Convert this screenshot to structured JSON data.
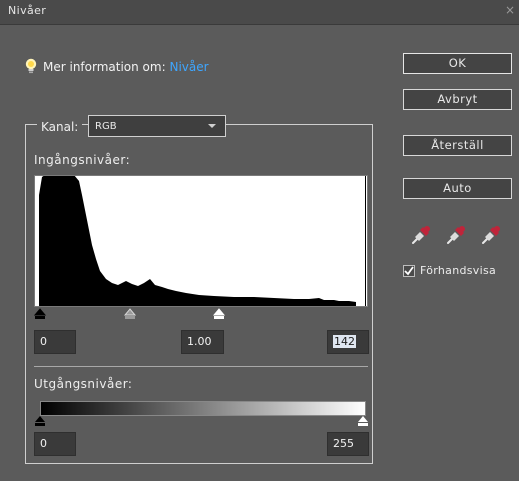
{
  "window": {
    "title": "Nivåer",
    "close": "×"
  },
  "info": {
    "prefix": "Mer information om:",
    "link": "Nivåer"
  },
  "buttons": {
    "ok": "OK",
    "cancel": "Avbryt",
    "reset": "Återställ",
    "auto": "Auto"
  },
  "channel": {
    "label": "Kanal:",
    "value": "RGB"
  },
  "input_levels": {
    "label": "Ingångsnivåer:",
    "black": "0",
    "gamma": "1.00",
    "white": "142"
  },
  "output_levels": {
    "label": "Utgångsnivåer:",
    "black": "0",
    "white": "255"
  },
  "preview": {
    "label": "Förhandsvisa",
    "checked": true
  },
  "icons": {
    "info": "lightbulb-icon",
    "eyedroppers": [
      "black-eyedropper-icon",
      "gray-eyedropper-icon",
      "white-eyedropper-icon"
    ]
  },
  "colors": {
    "link": "#3ea6ff",
    "dialog_bg": "#5b5b5b",
    "titlebar": "#4a4a4a",
    "dropper": "#c0243a"
  }
}
